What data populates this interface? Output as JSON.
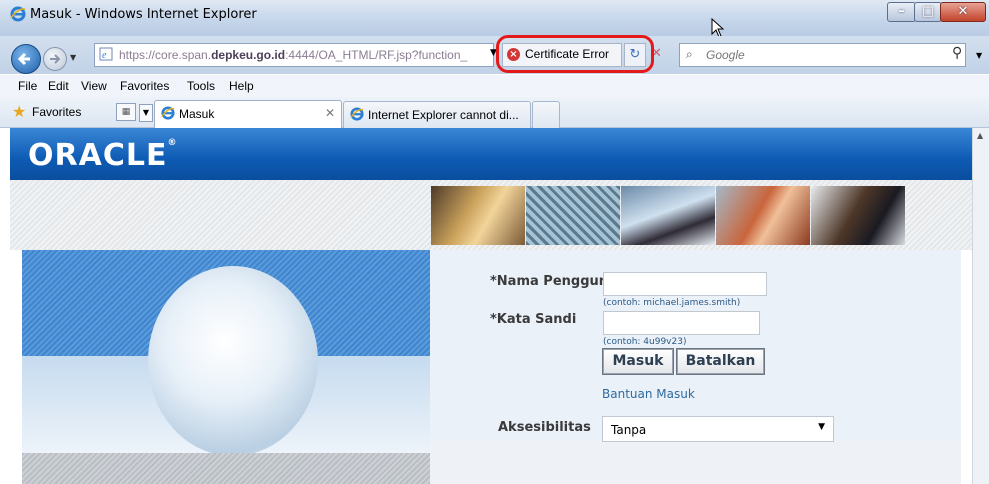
{
  "window": {
    "title": "Masuk - Windows Internet Explorer",
    "minimize_glyph": "–",
    "maximize_glyph": "□",
    "close_glyph": "✕"
  },
  "navbar": {
    "url_prefix": "https://core.span.",
    "url_domain": "depkeu.go.id",
    "url_suffix": ":4444/OA_HTML/RF.jsp?function_",
    "certificate_error_label": "Certificate Error",
    "search_placeholder": "Google"
  },
  "menu": {
    "items": [
      "File",
      "Edit",
      "View",
      "Favorites",
      "Tools",
      "Help"
    ]
  },
  "favorites_bar": {
    "favorites_label": "Favorites",
    "tabs": [
      {
        "label": "Masuk",
        "active": true
      },
      {
        "label": "Internet Explorer cannot di...",
        "active": false
      }
    ]
  },
  "page": {
    "logo_text": "ORACLE",
    "logo_mark": "®",
    "form": {
      "username_label": "*Nama Pengguna",
      "username_value": "",
      "username_hint": "(contoh: michael.james.smith)",
      "password_label": "*Kata Sandi",
      "password_value": "",
      "password_hint": "(contoh: 4u99v23)",
      "login_button": "Masuk",
      "cancel_button": "Batalkan",
      "help_link": "Bantuan Masuk",
      "accessibility_label": "Aksesibilitas",
      "accessibility_value": "Tanpa"
    }
  },
  "icons": {
    "ie": "ie-logo-icon",
    "back": "back-arrow-icon",
    "forward": "forward-arrow-icon",
    "certificate_error": "certificate-error-icon",
    "refresh": "refresh-icon",
    "stop": "stop-icon",
    "search": "search-icon",
    "favorites_star": "favorites-star-icon"
  },
  "colors": {
    "highlight": "#e41a1a",
    "oracle_blue": "#0e5bb4",
    "link": "#2e6a9e"
  }
}
